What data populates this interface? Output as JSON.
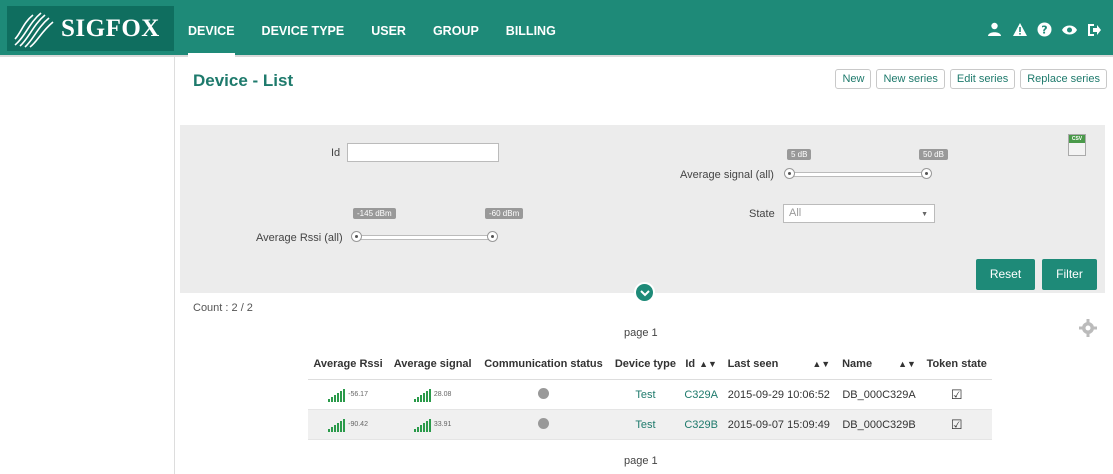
{
  "brand": {
    "name": "SIGFOX"
  },
  "nav": [
    {
      "label": "DEVICE",
      "active": true
    },
    {
      "label": "DEVICE TYPE",
      "active": false
    },
    {
      "label": "USER",
      "active": false
    },
    {
      "label": "GROUP",
      "active": false
    },
    {
      "label": "BILLING",
      "active": false
    }
  ],
  "top_icons": [
    "user-icon",
    "alert-icon",
    "help-icon",
    "eye-icon",
    "logout-icon"
  ],
  "page": {
    "title": "Device - List"
  },
  "actions": {
    "new": "New",
    "new_series": "New series",
    "edit_series": "Edit series",
    "replace_series": "Replace series"
  },
  "filters": {
    "id_label": "Id",
    "id_value": "",
    "rssi_label": "Average Rssi (all)",
    "rssi_min": "-145 dBm",
    "rssi_max": "-60 dBm",
    "signal_label": "Average signal (all)",
    "signal_min": "5 dB",
    "signal_max": "50 dB",
    "state_label": "State",
    "state_value": "All",
    "csv_tag": "CSV",
    "reset_label": "Reset",
    "filter_label": "Filter"
  },
  "count_text": "Count : 2 / 2",
  "pagination": {
    "top": "page 1",
    "bottom": "page 1"
  },
  "table": {
    "headers": [
      "Average Rssi",
      "Average signal",
      "Communication status",
      "Device type",
      "Id",
      "Last seen",
      "Name",
      "Token state"
    ],
    "rows": [
      {
        "rssi": "-56.17",
        "signal": "28.08",
        "device_type": "Test",
        "id": "C329A",
        "last_seen": "2015-09-29 10:06:52",
        "name": "DB_000C329A",
        "token_checked": true
      },
      {
        "rssi": "-90.42",
        "signal": "33.91",
        "device_type": "Test",
        "id": "C329B",
        "last_seen": "2015-09-07 15:09:49",
        "name": "DB_000C329B",
        "token_checked": true
      }
    ]
  },
  "colors": {
    "brand": "#1e8a78",
    "brand_dark": "#0f6e5f",
    "signal_bars": "#2a9a4a"
  }
}
